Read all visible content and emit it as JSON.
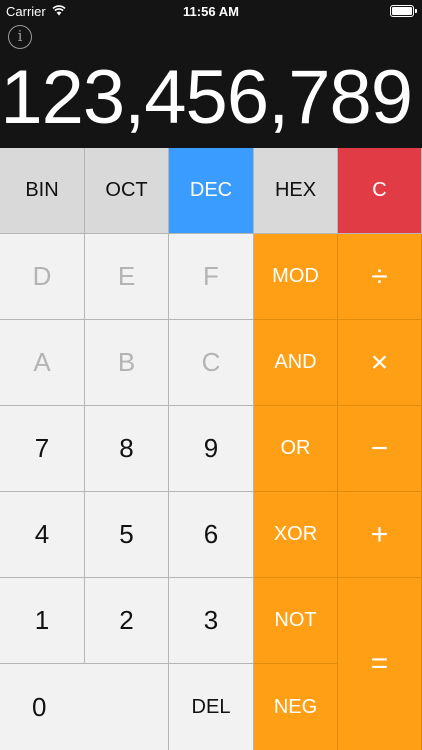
{
  "status": {
    "carrier": "Carrier",
    "time": "11:56 AM"
  },
  "info": {
    "label": "i"
  },
  "display": {
    "value": "123,456,789"
  },
  "modes": {
    "bin": "BIN",
    "oct": "OCT",
    "dec": "DEC",
    "hex": "HEX",
    "clear": "C"
  },
  "keys": {
    "d": "D",
    "e": "E",
    "f": "F",
    "mod": "MOD",
    "divide": "÷",
    "a": "A",
    "b": "B",
    "c": "C",
    "and": "AND",
    "multiply": "×",
    "seven": "7",
    "eight": "8",
    "nine": "9",
    "or": "OR",
    "minus": "−",
    "four": "4",
    "five": "5",
    "six": "6",
    "xor": "XOR",
    "plus": "+",
    "one": "1",
    "two": "2",
    "three": "3",
    "not": "NOT",
    "equals": "=",
    "zero": "0",
    "del": "DEL",
    "neg": "NEG"
  },
  "colors": {
    "active_mode": "#3a9cff",
    "clear": "#e13c45",
    "operator": "#ff9f16",
    "digit_bg": "#f2f2f2",
    "mode_bg": "#d9d9d9",
    "display_bg": "#141414"
  },
  "state": {
    "selected_mode": "DEC",
    "battery_level": 1.0
  }
}
